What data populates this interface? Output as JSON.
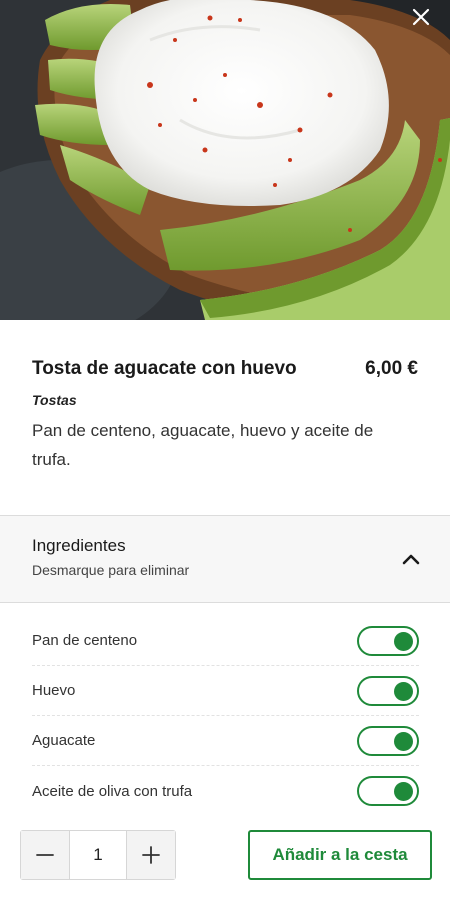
{
  "product": {
    "title": "Tosta de aguacate con huevo",
    "price": "6,00 €",
    "category": "Tostas",
    "description": "Pan de centeno, aguacate, huevo y aceite de trufa.",
    "image_alt": "photo-toast-avocado-poached-egg"
  },
  "ingredients": {
    "title": "Ingredientes",
    "subtitle": "Desmarque para eliminar",
    "expanded": true,
    "items": [
      {
        "name": "Pan de centeno",
        "checked": true
      },
      {
        "name": "Huevo",
        "checked": true
      },
      {
        "name": "Aguacate",
        "checked": true
      },
      {
        "name": "Aceite de oliva con trufa",
        "checked": true
      }
    ]
  },
  "quantity": {
    "value": "1",
    "minus_icon": "minus-icon",
    "plus_icon": "plus-icon"
  },
  "actions": {
    "add_to_cart_label": "Añadir a la cesta",
    "close_icon": "close-icon"
  },
  "colors": {
    "accent": "#1f8a3a",
    "header_bg": "#f7f7f7"
  }
}
